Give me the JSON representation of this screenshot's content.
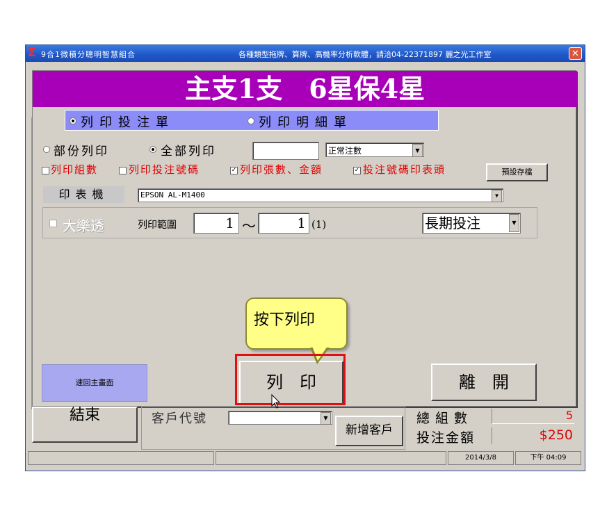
{
  "window": {
    "app_icon": "Σ",
    "title": "9合1微積分聰明智慧組合",
    "contact": "各種類型拖牌、算牌、高機率分析軟體，請洽04-22371897 麗之光工作室",
    "close": "✕"
  },
  "dialog": {
    "banner": "主支1支　6星保4星",
    "print_mode": {
      "options": [
        "列印投注單",
        "列印明細單"
      ],
      "selected": "列印投注單"
    },
    "range_mode": {
      "options": [
        "部份列印",
        "全部列印"
      ],
      "selected": "全部列印"
    },
    "count_input": "",
    "count_select": "正常注數",
    "checks": [
      {
        "label": "列印組數",
        "checked": false
      },
      {
        "label": "列印投注號碼",
        "checked": false
      },
      {
        "label": "列印張數、金額",
        "checked": true
      },
      {
        "label": "投注號碼印表頭",
        "checked": true
      }
    ],
    "save_default_label": "預設存檔",
    "printer_label": "印表機",
    "printer_value": "EPSON AL-M1400",
    "lotto_checkbox": "大樂透",
    "range_label": "列印範圍",
    "range_from": "1",
    "range_sep": "～",
    "range_to": "1",
    "range_count": "(1)",
    "period_select": "長期投注",
    "back_button": "速回主畫面",
    "print_button": "列　印",
    "exit_button": "離　開",
    "callout": "按下列印"
  },
  "footer": {
    "end_button": "結束",
    "customer_label": "客戶代號",
    "customer_value": "",
    "new_customer_button": "新增客戶",
    "total_groups_label": "總組數",
    "total_groups_value": "5",
    "amount_label": "投注金額",
    "amount_value": "$250"
  },
  "statusbar": {
    "date": "2014/3/8",
    "time": "下午 04:09"
  }
}
